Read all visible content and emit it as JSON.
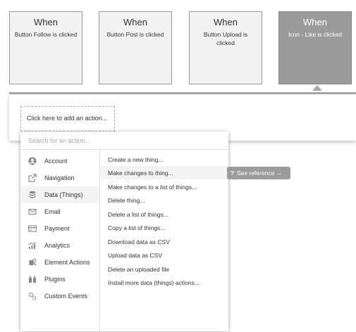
{
  "events": [
    {
      "when": "When",
      "desc": "Button Follow is clicked"
    },
    {
      "when": "When",
      "desc": "Button Post is clicked"
    },
    {
      "when": "When",
      "desc": "Button Upload is clicked"
    },
    {
      "when": "When",
      "desc": "Icon - Like is clicked"
    }
  ],
  "action_panel": {
    "add_action_label": "Click here to add an action..."
  },
  "dropdown": {
    "search_placeholder": "Search for an action...",
    "categories": [
      {
        "label": "Account",
        "icon": "user-icon"
      },
      {
        "label": "Navigation",
        "icon": "navigation-icon"
      },
      {
        "label": "Data (Things)",
        "icon": "database-icon",
        "selected": true
      },
      {
        "label": "Email",
        "icon": "email-icon"
      },
      {
        "label": "Payment",
        "icon": "payment-icon"
      },
      {
        "label": "Analytics",
        "icon": "analytics-icon"
      },
      {
        "label": "Element Actions",
        "icon": "element-actions-icon"
      },
      {
        "label": "Plugins",
        "icon": "plugins-icon"
      },
      {
        "label": "Custom Events",
        "icon": "custom-events-icon"
      }
    ],
    "actions": [
      "Create a new thing...",
      "Make changes to thing...",
      "Make changes to a list of things...",
      "Delete thing...",
      "Delete a list of things...",
      "Copy a list of things...",
      "Download data as CSV",
      "Upload data as CSV",
      "Delete an uploaded file",
      "Install more data (things) actions..."
    ],
    "highlighted_action": "Make changes to thing..."
  },
  "tooltip": {
    "icon": "?",
    "label": "See reference →"
  },
  "colors": {
    "active_card": "#9b9b9b",
    "card": "#f2f2f2",
    "tooltip": "#9b9b9b"
  }
}
